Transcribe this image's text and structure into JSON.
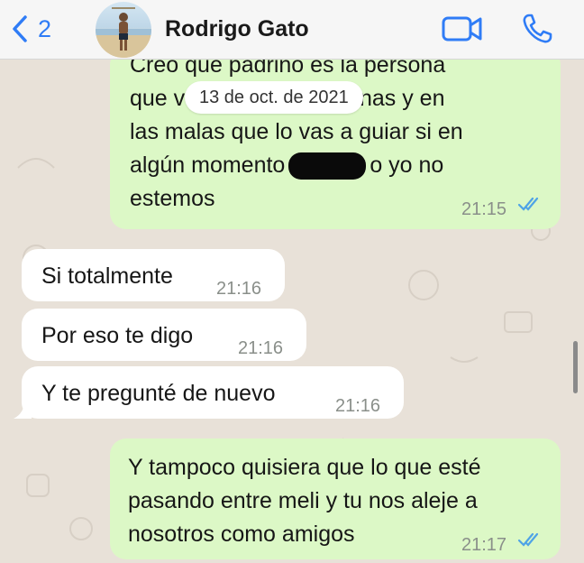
{
  "header": {
    "back_count": "2",
    "contact_name": "Rodrigo Gato"
  },
  "date_separator": "13 de oct. de 2021",
  "messages": [
    {
      "direction": "outgoing",
      "lines": [
        "Creo que padrino es la persona",
        "que v",
        "uenas y en",
        "las malas que lo vas a guiar si en",
        "algún momento",
        "o yo no",
        "estemos"
      ],
      "time": "21:15",
      "status": "read"
    },
    {
      "direction": "incoming",
      "text": "Si totalmente",
      "time": "21:16"
    },
    {
      "direction": "incoming",
      "text": "Por eso te digo",
      "time": "21:16"
    },
    {
      "direction": "incoming",
      "text": "Y te pregunté de nuevo",
      "time": "21:16"
    },
    {
      "direction": "outgoing",
      "lines": [
        "Y tampoco quisiera que lo que esté",
        "pasando entre meli y tu nos aleje a",
        "nosotros como amigos"
      ],
      "time": "21:17",
      "status": "read"
    }
  ],
  "colors": {
    "accent": "#2f7cf6",
    "outgoing_bubble": "#dcf8c6",
    "incoming_bubble": "#ffffff",
    "read_ticks": "#4fa3e6"
  },
  "icons": {
    "back": "chevron-left-icon",
    "video": "video-camera-icon",
    "call": "phone-icon",
    "read": "double-check-icon"
  }
}
